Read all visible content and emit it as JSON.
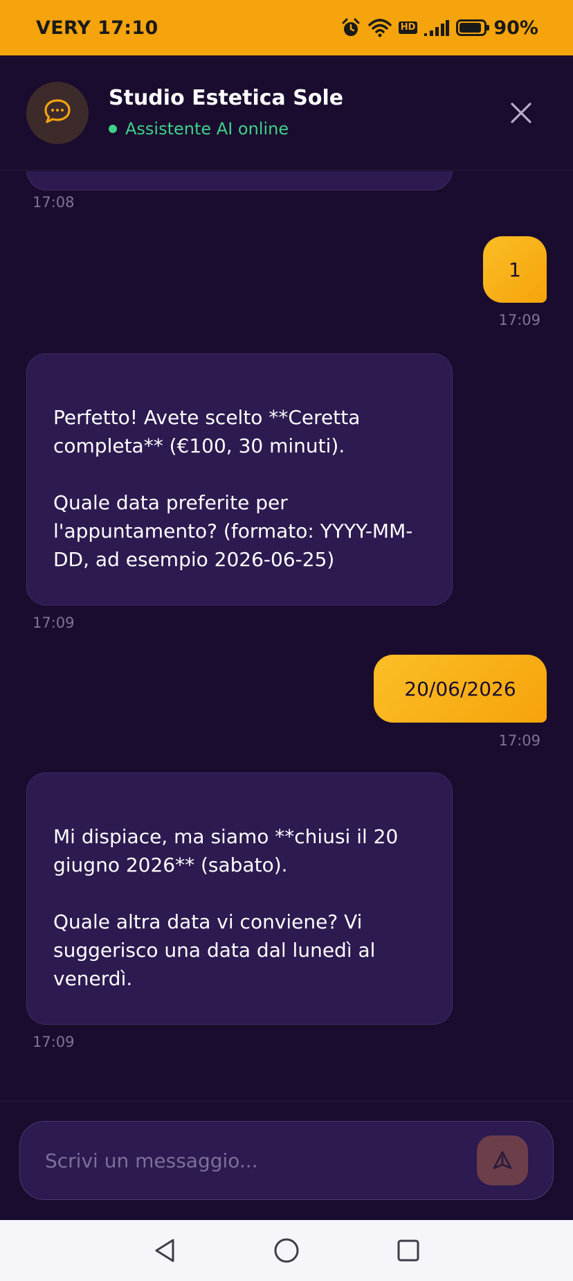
{
  "status_bar": {
    "carrier_time": "VERY 17:10",
    "hd_label": "HD",
    "battery": "90%",
    "battery_level": 0.9
  },
  "header": {
    "title": "Studio Estetica Sole",
    "status": "Assistente AI online",
    "status_color": "#3fd08a"
  },
  "messages": [
    {
      "role": "bot",
      "time": "17:08",
      "text": ""
    },
    {
      "role": "user",
      "time": "17:09",
      "text": "1"
    },
    {
      "role": "bot",
      "time": "17:09",
      "text": "Perfetto! Avete scelto **Ceretta completa** (€100, 30 minuti).\n\nQuale data preferite per l'appuntamento? (formato: YYYY-MM-DD, ad esempio 2026-06-25)"
    },
    {
      "role": "user",
      "time": "17:09",
      "text": "20/06/2026"
    },
    {
      "role": "bot",
      "time": "17:09",
      "text": "Mi dispiace, ma siamo **chiusi il 20 giugno 2026** (sabato).\n\nQuale altra data vi conviene? Vi suggerisco una data dal lunedì al venerdì."
    }
  ],
  "composer": {
    "placeholder": "Scrivi un messaggio...",
    "value": ""
  },
  "colors": {
    "accent": "#f5a40d",
    "background": "#1a0c2e",
    "bot_bubble": "#2c1a50"
  },
  "icons": {
    "avatar": "chat-bubble-icon",
    "close": "close-icon",
    "send": "send-icon",
    "nav_back": "back-triangle-icon",
    "nav_home": "home-circle-icon",
    "nav_recents": "recents-square-icon"
  }
}
